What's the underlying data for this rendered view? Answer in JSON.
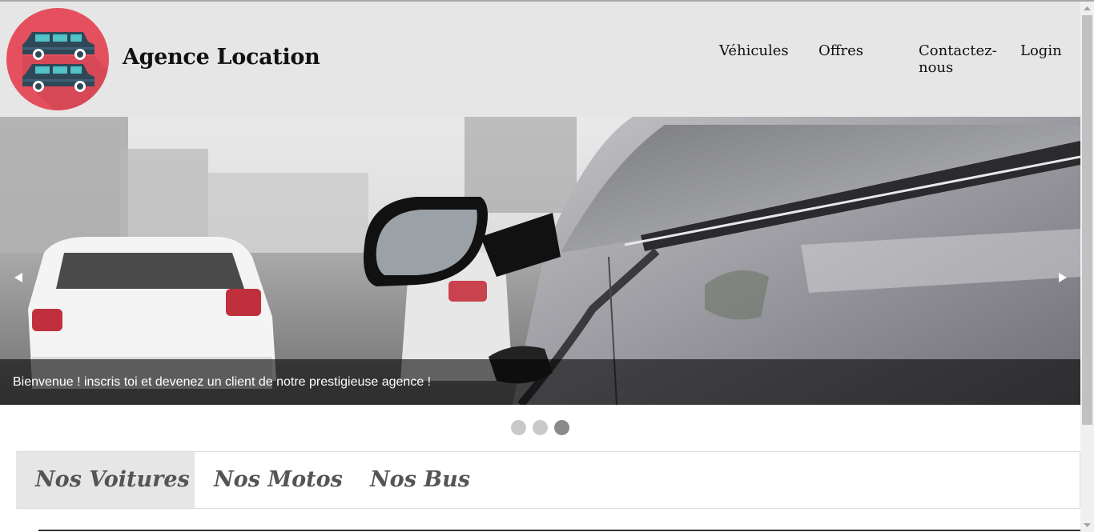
{
  "header": {
    "brand": "Agence Location",
    "logo_icon": "car-rental-logo-icon",
    "nav": [
      {
        "label": "Véhicules"
      },
      {
        "label": "Offres"
      },
      {
        "label": "Contactez-nous"
      },
      {
        "label": "Login"
      }
    ]
  },
  "carousel": {
    "caption": "Bienvenue ! inscris toi et devenez un client de notre prestigieuse agence !",
    "slide_count": 3,
    "active_slide": 3,
    "prev_icon": "arrow-left-icon",
    "next_icon": "arrow-right-icon"
  },
  "tabs": [
    {
      "label": "Nos Voitures",
      "active": true
    },
    {
      "label": "Nos Motos",
      "active": false
    },
    {
      "label": "Nos Bus",
      "active": false
    }
  ],
  "colors": {
    "header_bg": "#e6e6e6",
    "logo_bg": "#e5505f",
    "car_color": "#2f4858",
    "window_color": "#4fc3c7",
    "active_tab_bg": "#e6e6e6",
    "active_dot": "#8a8a8a",
    "inactive_dot": "#c9c9c9"
  }
}
